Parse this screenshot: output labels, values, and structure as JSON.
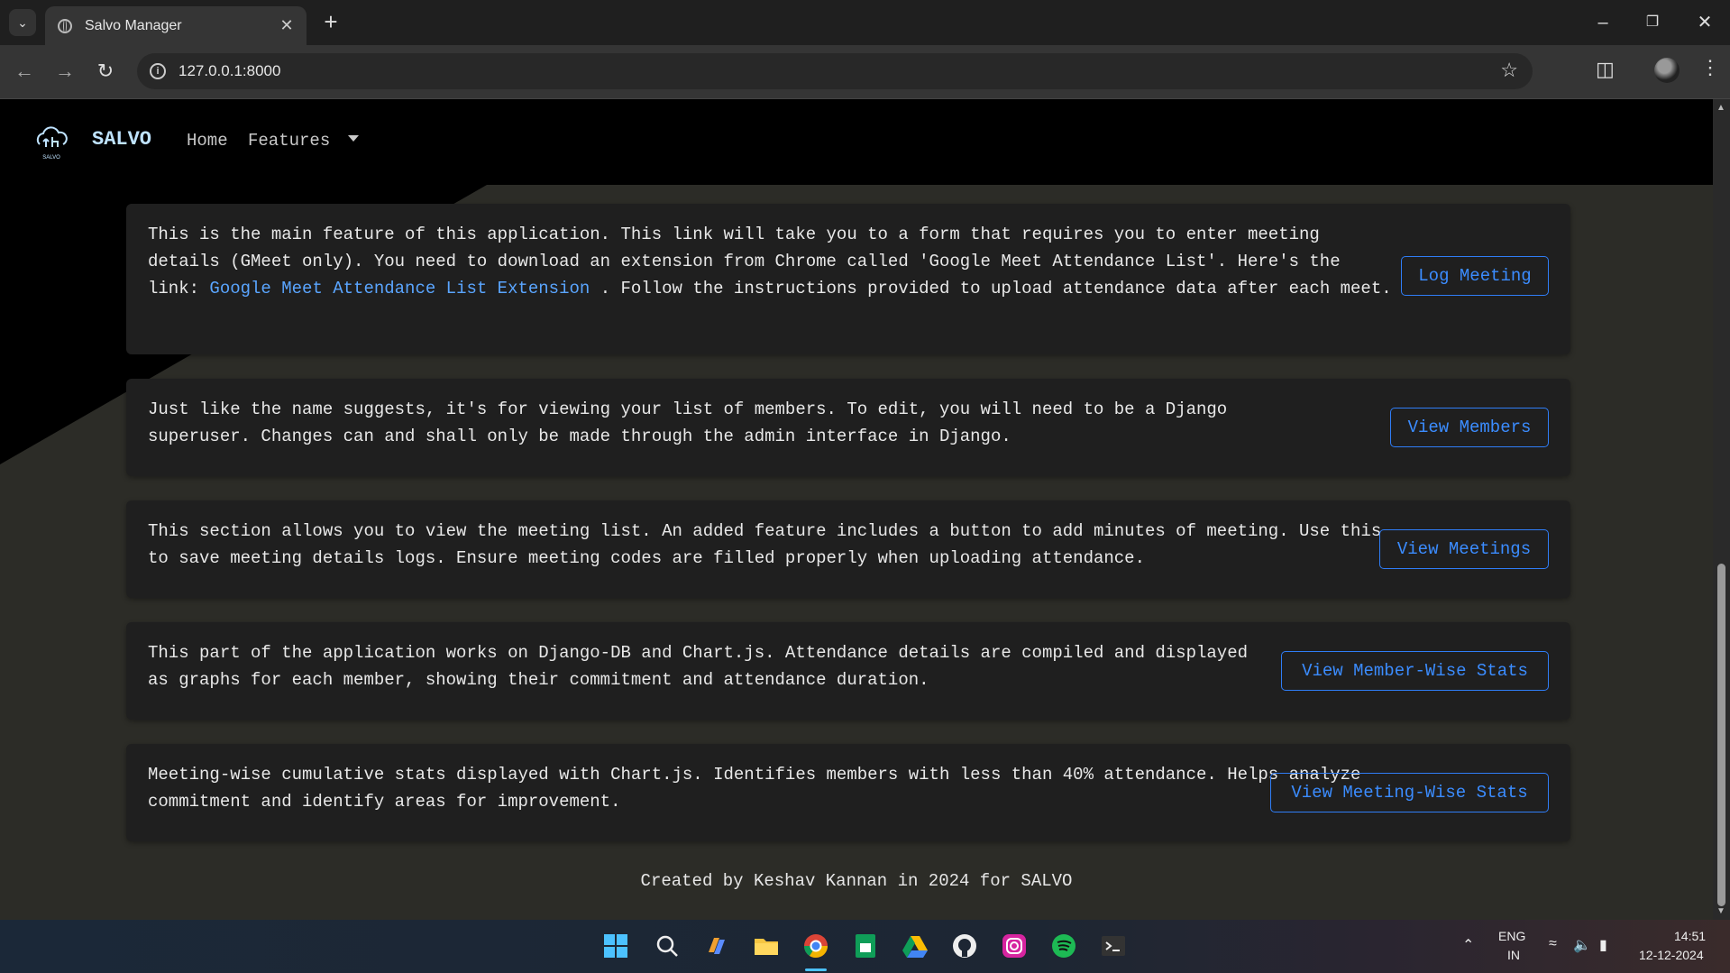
{
  "browser": {
    "tab_title": "Salvo Manager",
    "url": "127.0.0.1:8000"
  },
  "site": {
    "brand": "SALVO",
    "logo_text": "SALVO",
    "nav": {
      "home": "Home",
      "features": "Features"
    }
  },
  "cards": [
    {
      "text_before": "This is the main feature of this application. This link will take you to a form that requires you to enter meeting details (GMeet only). You need to download an extension from Chrome called 'Google Meet Attendance List'. Here's the link: ",
      "link_text": "Google Meet Attendance List Extension",
      "text_after": " . Follow the instructions provided to upload attendance data after each meet.",
      "button": "Log Meeting"
    },
    {
      "text": "Just like the name suggests, it's for viewing your list of members. To edit, you will need to be a Django superuser. Changes can and shall only be made through the admin interface in Django.",
      "button": "View Members"
    },
    {
      "text": "This section allows you to view the meeting list. An added feature includes a button to add minutes of meeting. Use this to save meeting details logs. Ensure meeting codes are filled properly when uploading attendance.",
      "button": "View Meetings"
    },
    {
      "text": "This part of the application works on Django-DB and Chart.js. Attendance details are compiled and displayed as graphs for each member, showing their commitment and attendance duration.",
      "button": "View Member-Wise Stats"
    },
    {
      "text": "Meeting-wise cumulative stats displayed with Chart.js. Identifies members with less than 40% attendance. Helps analyze commitment and identify areas for improvement.",
      "button": "View Meeting-Wise Stats"
    }
  ],
  "footer": "Created by Keshav Kannan in 2024 for SALVO",
  "taskbar": {
    "lang": "ENG",
    "region": "IN",
    "time": "14:51",
    "date": "12-12-2024"
  }
}
